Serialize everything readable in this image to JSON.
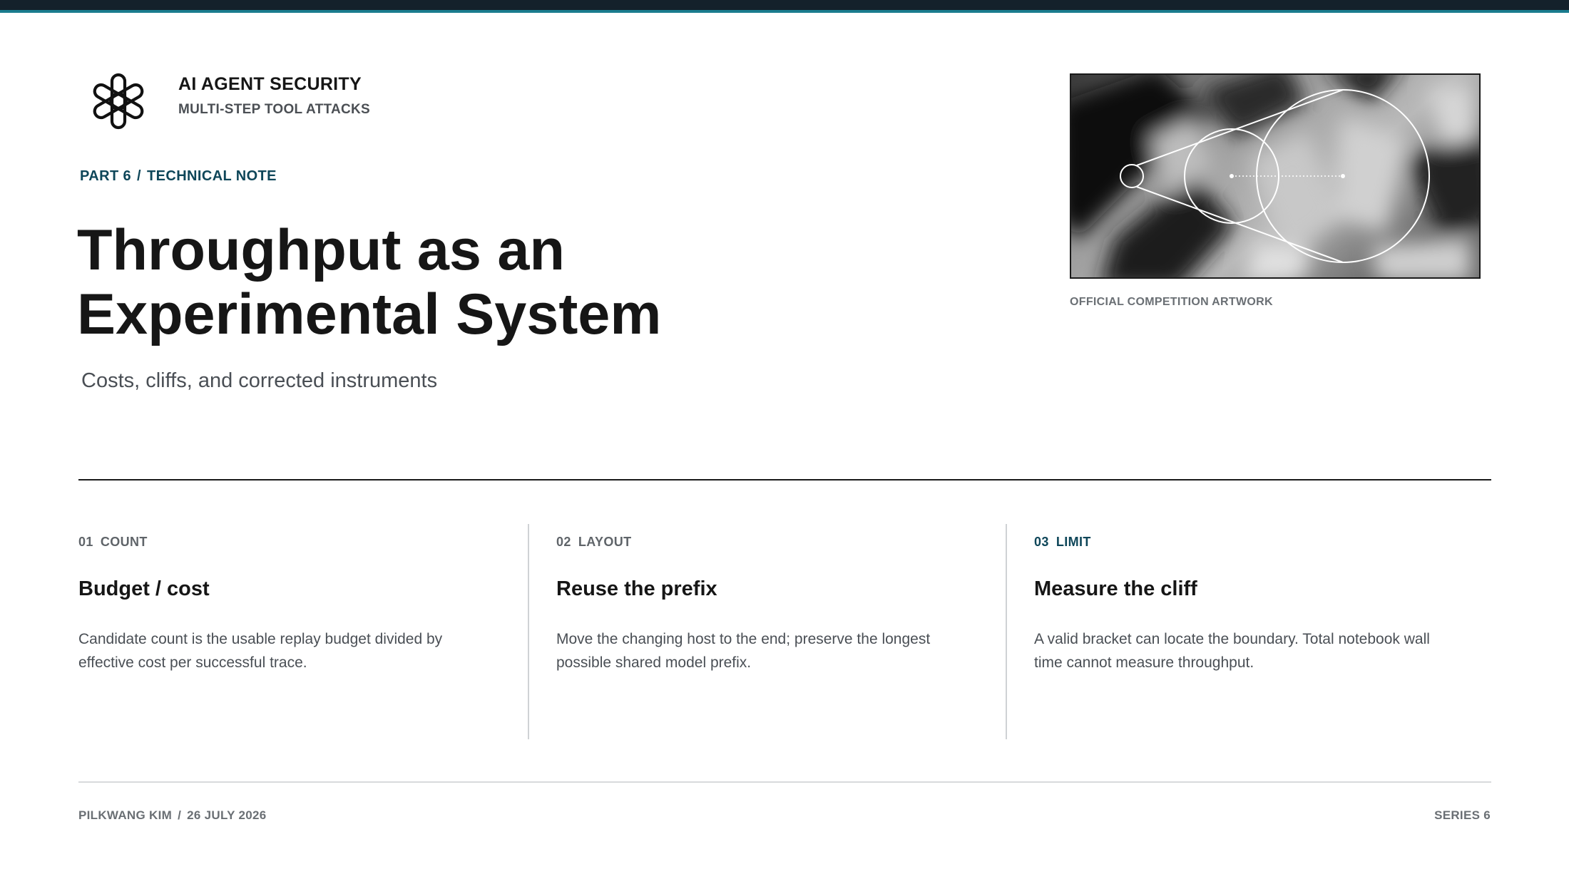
{
  "brand": {
    "title": "AI AGENT SECURITY",
    "subtitle": "MULTI-STEP TOOL ATTACKS"
  },
  "kicker": {
    "part": "PART 6",
    "separator": "/",
    "section": "TECHNICAL NOTE"
  },
  "title_lines": [
    "Throughput as an",
    "Experimental System"
  ],
  "subtitle": "Costs, cliffs, and corrected instruments",
  "artwork": {
    "caption": "OFFICIAL COMPETITION ARTWORK"
  },
  "columns": [
    {
      "num": "01",
      "label": "COUNT",
      "heading": "Budget / cost",
      "body": "Candidate count is the usable replay budget divided by effective cost per successful trace.",
      "highlighted": false
    },
    {
      "num": "02",
      "label": "LAYOUT",
      "heading": "Reuse the prefix",
      "body": "Move the changing host to the end; preserve the longest possible shared model prefix.",
      "highlighted": false
    },
    {
      "num": "03",
      "label": "LIMIT",
      "heading": "Measure the cliff",
      "body": "A valid bracket can locate the boundary. Total notebook wall time cannot measure throughput.",
      "highlighted": true
    }
  ],
  "footer": {
    "author": "PILKWANG KIM",
    "separator": "/",
    "date": "26 JULY 2026",
    "series": "SERIES 6"
  },
  "colors": {
    "accent": "#0e4659",
    "topbar": "#14212b",
    "topbar_accent": "#1a7c8e",
    "text": "#161616",
    "muted": "#4a4f55"
  },
  "icons": {
    "logo": "knot-logo-icon"
  }
}
